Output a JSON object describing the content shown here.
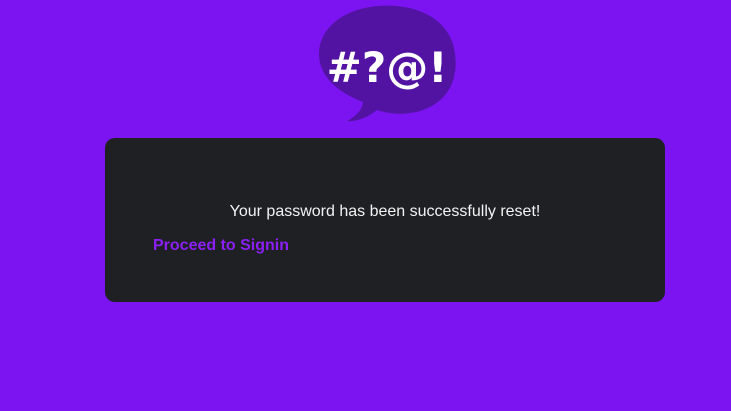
{
  "colors": {
    "background": "#7b14f0",
    "logo_bubble": "#5213a3",
    "logo_text": "#ffffff",
    "card_background": "#1f2024",
    "message_text": "#f2f2f2",
    "link": "#8b1ff5"
  },
  "logo": {
    "icon": "speech-bubble-icon",
    "text": "#?@!"
  },
  "card": {
    "message": "Your password has been successfully reset!",
    "link_label": "Proceed to Signin"
  }
}
